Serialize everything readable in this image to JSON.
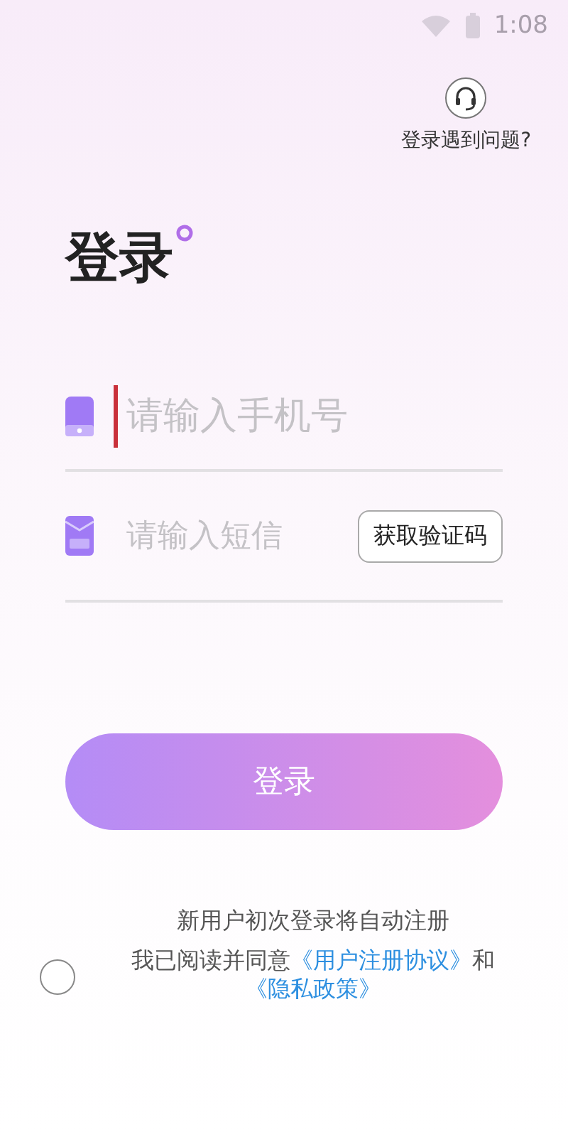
{
  "status_bar": {
    "time": "1:08"
  },
  "help": {
    "label": "登录遇到问题?"
  },
  "title": "登录",
  "phone_field": {
    "placeholder": "请输入手机号",
    "focused": true
  },
  "code_field": {
    "placeholder": "请输入短信"
  },
  "get_code_button": "获取验证码",
  "login_button": "登录",
  "agreement": {
    "notice": "新用户初次登录将自动注册",
    "checked": false,
    "text": "我已阅读并同意",
    "user_link": "《用户注册协议》",
    "joiner": "和",
    "privacy_link": "《隐私政策》"
  }
}
